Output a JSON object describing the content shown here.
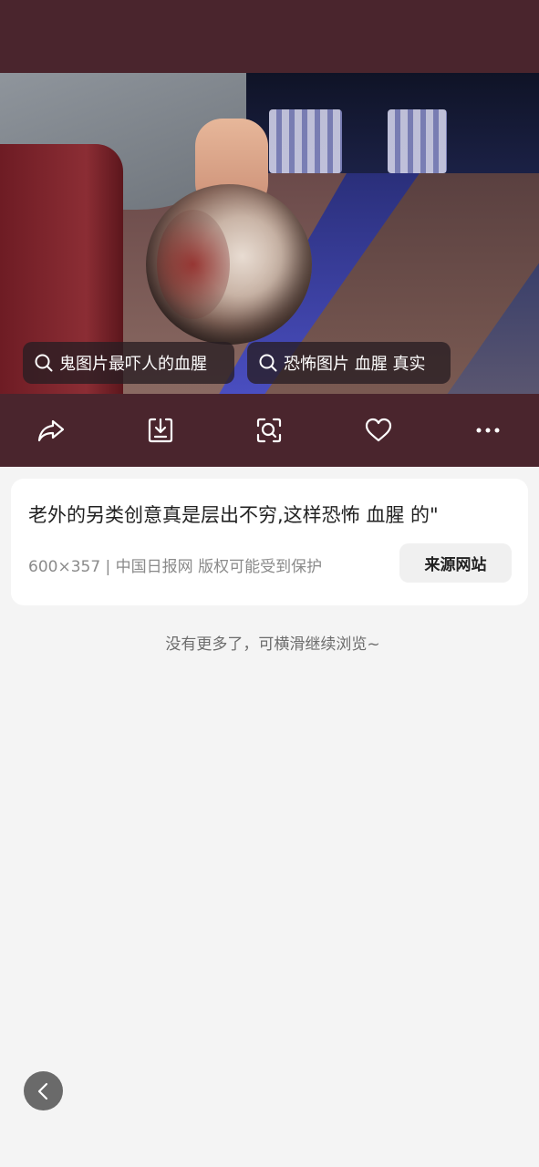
{
  "colors": {
    "top_background": "#4a252d",
    "page_background": "#f4f4f4",
    "card_background": "#ffffff",
    "chip_background": "#281e23",
    "text_primary": "#222222",
    "text_secondary": "#8a8a8a"
  },
  "image": {
    "alt_icon": "photo-image"
  },
  "related_searches": [
    {
      "label": "鬼图片最吓人的血腥",
      "icon": "search-icon"
    },
    {
      "label": "恐怖图片 血腥 真实",
      "icon": "search-icon"
    }
  ],
  "actions": [
    {
      "name": "share",
      "icon": "share-icon"
    },
    {
      "name": "download",
      "icon": "download-icon"
    },
    {
      "name": "visual-search",
      "icon": "scan-icon"
    },
    {
      "name": "favorite",
      "icon": "heart-icon"
    },
    {
      "name": "more",
      "icon": "more-icon"
    }
  ],
  "card": {
    "title": "老外的另类创意真是层出不穷,这样恐怖 血腥 的\"",
    "meta": "600×357 | 中国日报网 版权可能受到保护",
    "source_button": "来源网站"
  },
  "end_note": "没有更多了，可横滑继续浏览~",
  "back_button": {
    "icon": "chevron-left-icon"
  }
}
